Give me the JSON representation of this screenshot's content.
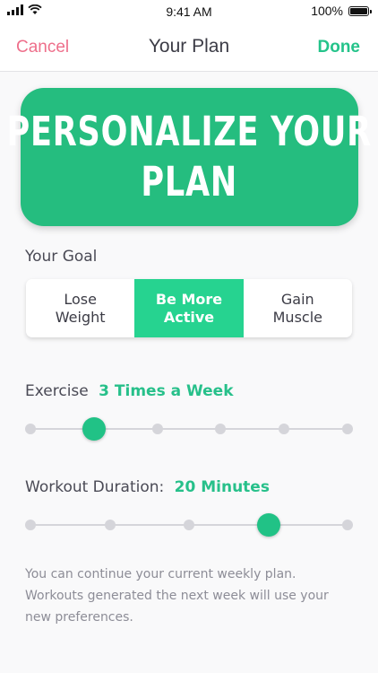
{
  "status_bar": {
    "time": "9:41 AM",
    "battery_text": "100%",
    "battery_level": 1.0,
    "icons": [
      "signal-icon",
      "wifi-icon",
      "battery-icon"
    ]
  },
  "nav": {
    "cancel_label": "Cancel",
    "title": "Your Plan",
    "done_label": "Done"
  },
  "hero": {
    "line1": "PERSONALIZE YOUR",
    "line2": "PLAN"
  },
  "goal": {
    "label": "Your Goal",
    "options": [
      "Lose\nWeight",
      "Be More\nActive",
      "Gain\nMuscle"
    ],
    "selected_index": 1
  },
  "exercise": {
    "label": "Exercise",
    "value": "3 Times a Week",
    "steps": 6,
    "selected_step": 1
  },
  "duration": {
    "label": "Workout Duration:",
    "value": "20 Minutes",
    "steps": 5,
    "selected_step": 3
  },
  "info_text": "You can continue your current weekly plan. Workouts generated the next week will use your new preferences.",
  "colors": {
    "accent_green": "#25bd7f",
    "segment_active": "#26d390",
    "cancel_pink": "#ee6f8b",
    "value_green": "#27c08a",
    "background": "#f9f9fa"
  }
}
